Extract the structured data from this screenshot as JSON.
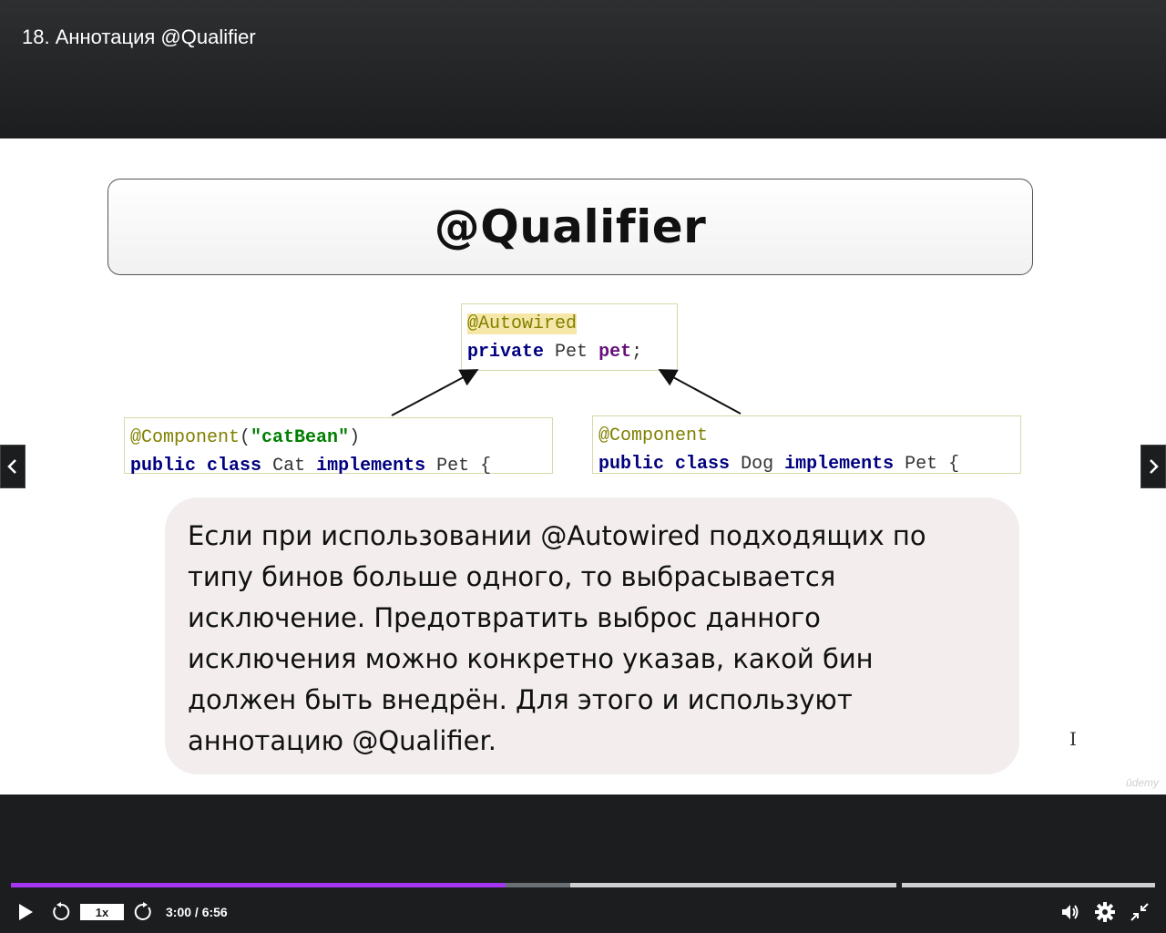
{
  "header": {
    "title": "18. Аннотация @Qualifier"
  },
  "slide": {
    "title": "@Qualifier",
    "field_code": {
      "annotation": "@Autowired",
      "kw_private": "private",
      "type": "Pet",
      "name": "pet",
      "semicolon": ";"
    },
    "cat_code": {
      "annotation": "@Component",
      "paren_open": "(",
      "bean_name": "\"catBean\"",
      "paren_close": ")",
      "kw_public": "public",
      "kw_class": "class",
      "class_name": "Cat",
      "kw_implements": "implements",
      "iface": "Pet",
      "brace": "{"
    },
    "dog_code": {
      "annotation": "@Component",
      "kw_public": "public",
      "kw_class": "class",
      "class_name": "Dog",
      "kw_implements": "implements",
      "iface": "Pet",
      "brace": "{"
    },
    "description_lines": [
      "Если при использовании @Autowired подходящих по",
      "типу бинов больше одного, то выбрасывается",
      "исключение. Предотвратить выброс данного",
      "исключения можно конкретно указав, какой бин",
      "должен быть внедрён. Для этого и используют",
      "аннотацию @Qualifier."
    ],
    "watermark": "ūdemy"
  },
  "player": {
    "speed": "1x",
    "time": "3:00 / 6:56",
    "played_fraction": 0.432,
    "buffered_fraction": 0.489,
    "colors": {
      "played": "#a435f0",
      "background": "#1c1d1f"
    }
  },
  "icons": {
    "prev": "chevron-left-icon",
    "next": "chevron-right-icon",
    "play": "play-icon",
    "rewind": "rewind-5-icon",
    "forward": "forward-5-icon",
    "volume": "volume-icon",
    "settings": "gear-icon",
    "exit_fullscreen": "exit-fullscreen-icon"
  }
}
